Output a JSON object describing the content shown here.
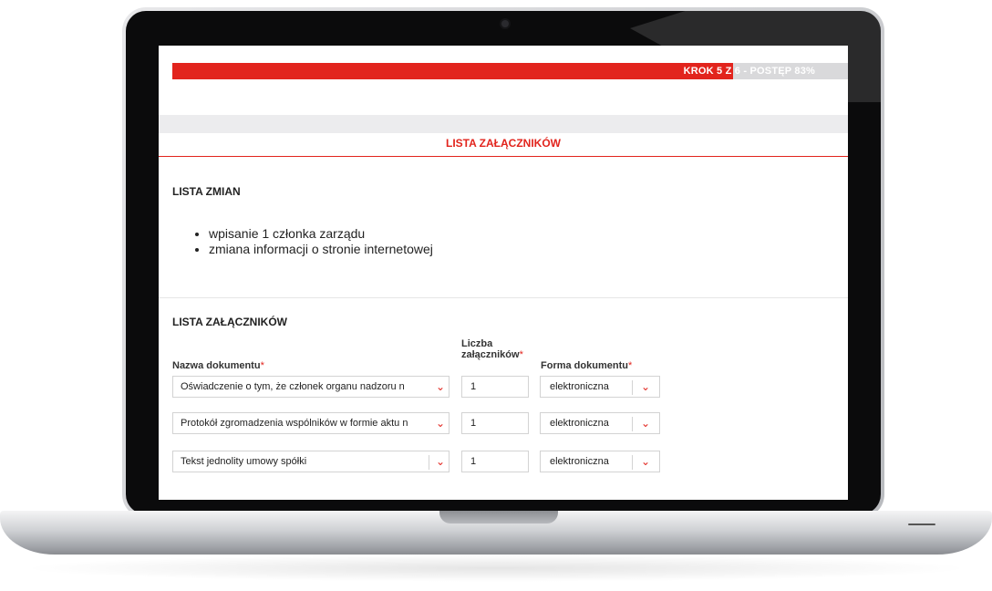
{
  "progress": {
    "label": "KROK 5 Z 6 - POSTĘP 83%",
    "percent": 83
  },
  "page": {
    "section_title": "LISTA ZAŁĄCZNIKÓW"
  },
  "changes": {
    "heading": "LISTA ZMIAN",
    "items": [
      "wpisanie 1 członka zarządu",
      "zmiana informacji o stronie internetowej"
    ]
  },
  "attachments": {
    "heading": "LISTA ZAŁĄCZNIKÓW",
    "columns": {
      "name": "Nazwa dokumentu",
      "count_line1": "Liczba",
      "count_line2": "załączników",
      "form": "Forma dokumentu",
      "required_mark": "*"
    },
    "rows": [
      {
        "name": "Oświadczenie o tym, że członek organu nadzoru n",
        "count": "1",
        "form": "elektroniczna"
      },
      {
        "name": "Protokół zgromadzenia wspólników w formie aktu n",
        "count": "1",
        "form": "elektroniczna"
      },
      {
        "name": "Tekst jednolity umowy spółki",
        "count": "1",
        "form": "elektroniczna"
      }
    ]
  },
  "colors": {
    "accent": "#e2241d",
    "progress_track": "#d9d9db"
  },
  "icons": {
    "dropdown": "chevron-down-icon",
    "camera": "camera-icon"
  }
}
